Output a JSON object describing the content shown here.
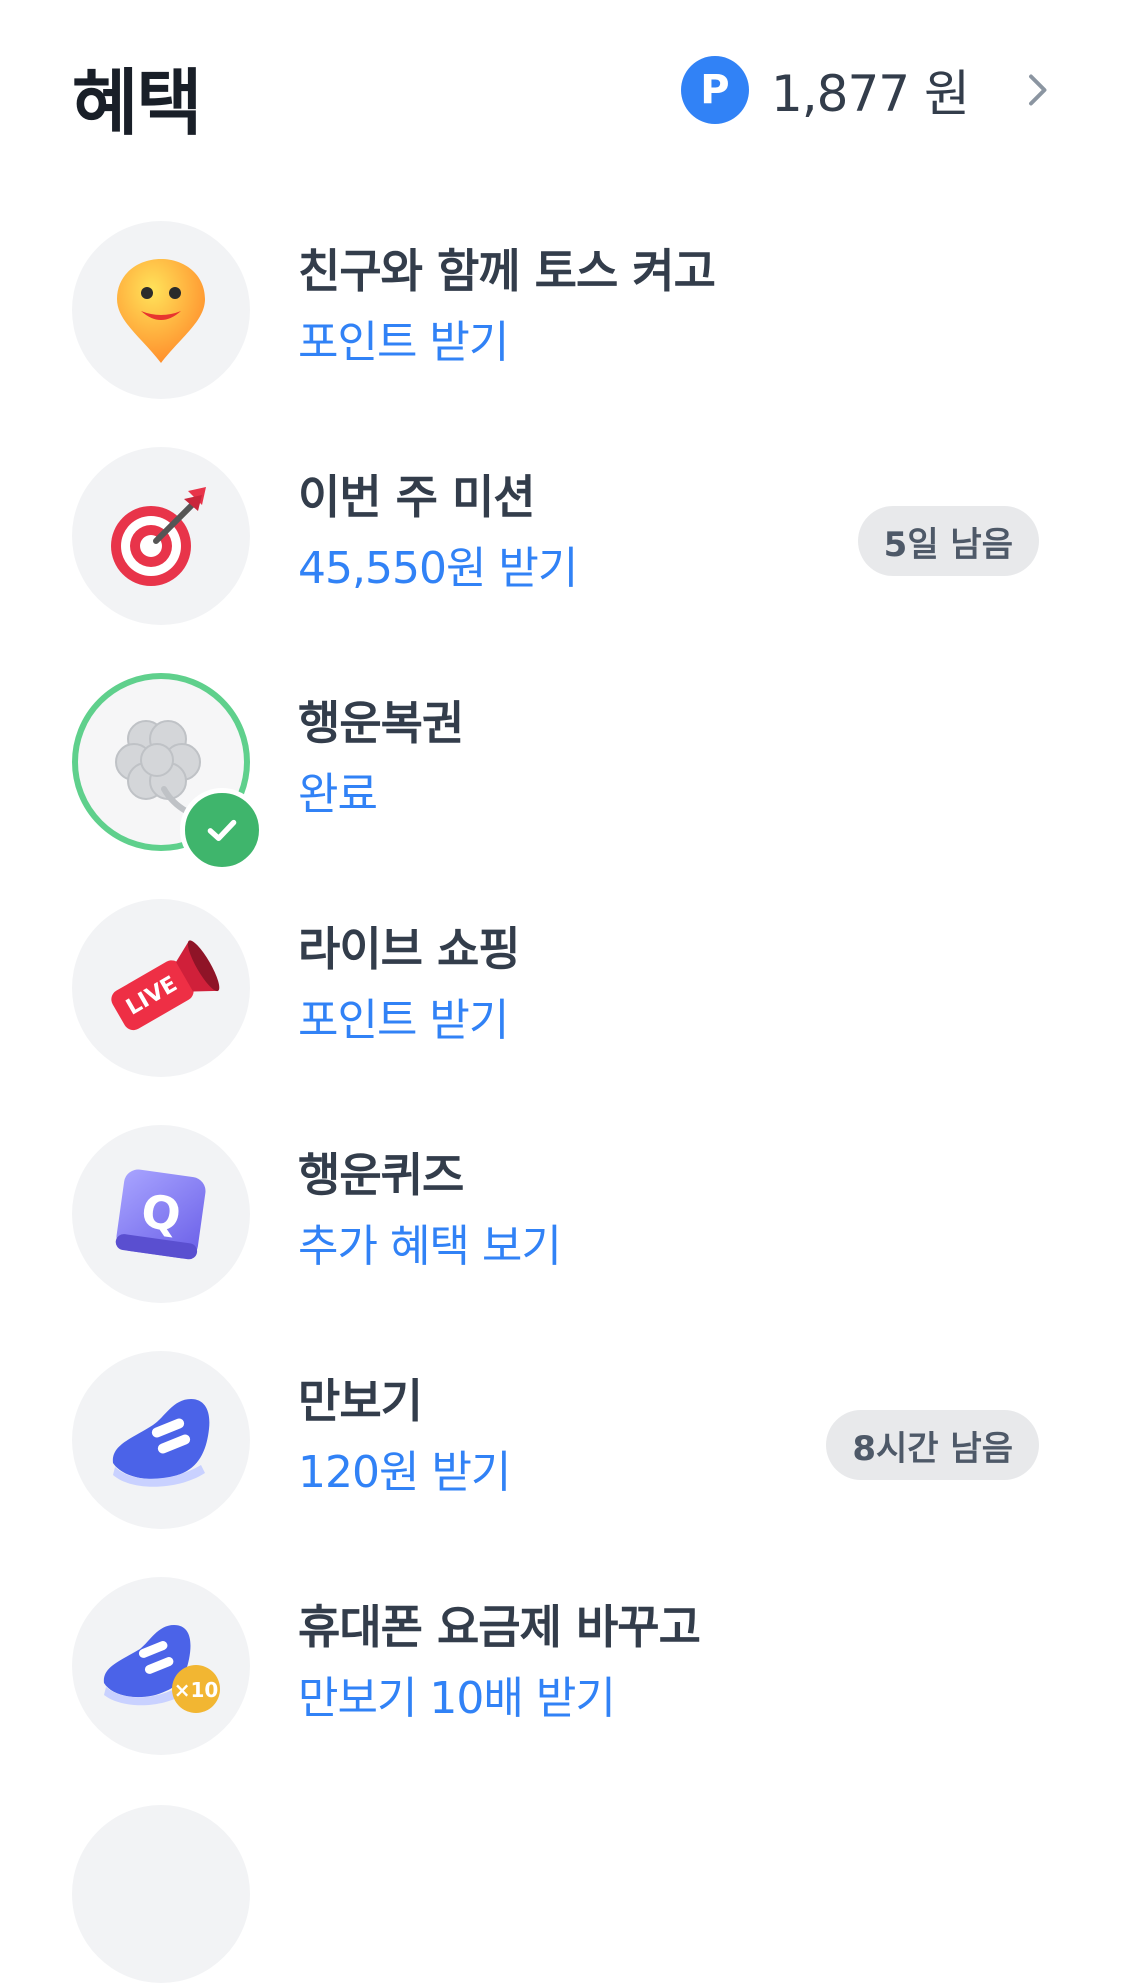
{
  "header": {
    "title": "혜택",
    "points_icon": "P",
    "points_amount": "1,877 원",
    "chevron_icon": "chevron-right-icon"
  },
  "items": [
    {
      "icon": "smile-pin-icon",
      "title": "친구와 함께 토스 켜고",
      "subtitle": "포인트 받기",
      "badge": ""
    },
    {
      "icon": "target-dart-icon",
      "title": "이번 주 미션",
      "subtitle": "45,550원 받기",
      "badge": "5일 남음"
    },
    {
      "icon": "clover-icon",
      "title": "행운복권",
      "subtitle": "완료",
      "badge": "",
      "completed": true
    },
    {
      "icon": "live-megaphone-icon",
      "title": "라이브 쇼핑",
      "subtitle": "포인트 받기",
      "badge": "",
      "icon_text": "LIVE"
    },
    {
      "icon": "quiz-q-icon",
      "title": "행운퀴즈",
      "subtitle": "추가 혜택 보기",
      "badge": "",
      "icon_text": "Q"
    },
    {
      "icon": "sneaker-icon",
      "title": "만보기",
      "subtitle": "120원 받기",
      "badge": "8시간 남음"
    },
    {
      "icon": "sneaker-x10-icon",
      "title": "휴대폰 요금제 바꾸고",
      "subtitle": "만보기 10배 받기",
      "badge": "",
      "icon_text": "×10"
    }
  ],
  "colors": {
    "accent": "#3182f6",
    "title_text": "#333d4b",
    "badge_bg": "#e8e9eb",
    "complete_green": "#3fb56c"
  }
}
